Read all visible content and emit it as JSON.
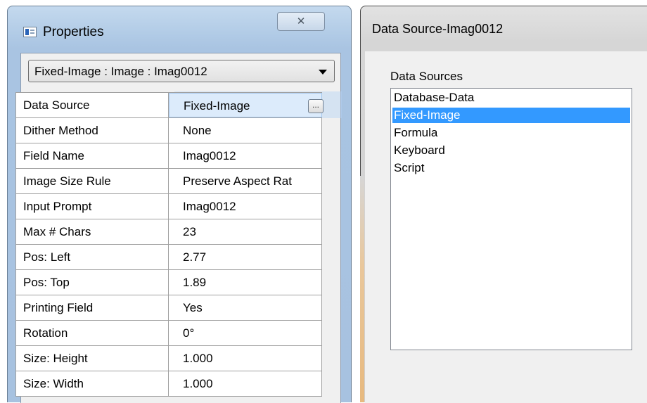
{
  "properties": {
    "title": "Properties",
    "close_symbol": "✕",
    "object_selector": "Fixed-Image : Image : Imag0012",
    "rows": [
      {
        "name": "Data Source",
        "value": "Fixed-Image"
      },
      {
        "name": "Dither Method",
        "value": "None"
      },
      {
        "name": "Field Name",
        "value": "Imag0012"
      },
      {
        "name": "Image Size Rule",
        "value": "Preserve  Aspect Rat"
      },
      {
        "name": "Input Prompt",
        "value": "Imag0012"
      },
      {
        "name": "Max # Chars",
        "value": "23"
      },
      {
        "name": "Pos: Left",
        "value": "2.77"
      },
      {
        "name": "Pos: Top",
        "value": "1.89"
      },
      {
        "name": "Printing Field",
        "value": "Yes"
      },
      {
        "name": "Rotation",
        "value": "0°"
      },
      {
        "name": "Size: Height",
        "value": "1.000"
      },
      {
        "name": "Size: Width",
        "value": "1.000"
      }
    ],
    "ellipsis_label": "..."
  },
  "data_source_dialog": {
    "title": "Data Source-Imag0012",
    "list_label": "Data Sources",
    "items": [
      "Database-Data",
      "Fixed-Image",
      "Formula",
      "Keyboard",
      "Script"
    ],
    "selected": "Fixed-Image"
  },
  "colors": {
    "selection": "#3399ff",
    "frame_blue": "#a9c4e2"
  }
}
